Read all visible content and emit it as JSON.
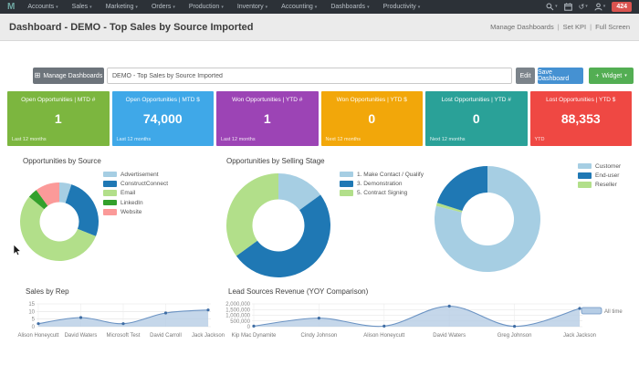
{
  "topnav": {
    "logo": "M",
    "menus": [
      "Accounts",
      "Sales",
      "Marketing",
      "Orders",
      "Production",
      "Inventory",
      "Accounting",
      "Dashboards",
      "Productivity"
    ],
    "icons": [
      "search-icon",
      "calendar-icon",
      "history-icon",
      "user-icon"
    ],
    "notification_badge": "424"
  },
  "titlebar": {
    "title": "Dashboard - DEMO - Top Sales by Source Imported",
    "links": [
      "Manage Dashboards",
      "Set KPI",
      "Full Screen"
    ]
  },
  "toolbar": {
    "manage_label": "Manage Dashboards",
    "dashboard_name": "DEMO - Top Sales by Source Imported",
    "edit_label": "Edit",
    "save_label": "Save Dashboard",
    "widget_plus": "+",
    "widget_label": "Widget"
  },
  "kpi_cards": [
    {
      "title": "Open Opportunities | MTD #",
      "value": "1",
      "footer": "Last 12 months",
      "color": "#7cb63f"
    },
    {
      "title": "Open Opportunities | MTD $",
      "value": "74,000",
      "footer": "Last 12 months",
      "color": "#3fa8e8"
    },
    {
      "title": "Won Opportunities | YTD #",
      "value": "1",
      "footer": "Last 12 months",
      "color": "#9c44b5"
    },
    {
      "title": "Won Opportunities | YTD $",
      "value": "0",
      "footer": "Next 12 months",
      "color": "#f2a70a"
    },
    {
      "title": "Lost Opportunities | YTD #",
      "value": "0",
      "footer": "Next 12 months",
      "color": "#2aa198"
    },
    {
      "title": "Lost Opportunities | YTD $",
      "value": "88,353",
      "footer": "YTD",
      "color": "#ef4843"
    }
  ],
  "chart_data": [
    {
      "type": "donut",
      "title": "Opportunities by Source",
      "legend_position": "right",
      "segments": [
        {
          "label": "Advertisement",
          "value": 5,
          "color": "#A6CEE3"
        },
        {
          "label": "ConstructConnect",
          "value": 26,
          "color": "#1F78B4"
        },
        {
          "label": "Email",
          "value": 55,
          "color": "#B2DF8A"
        },
        {
          "label": "LinkedIn",
          "value": 4,
          "color": "#33A02C"
        },
        {
          "label": "Website",
          "value": 10,
          "color": "#FB9A99"
        }
      ],
      "legend_order": [
        0,
        1,
        2,
        3,
        4
      ]
    },
    {
      "type": "donut",
      "title": "Opportunities by Selling Stage",
      "legend_position": "right",
      "segments": [
        {
          "label": "1. Make Contact / Qualify",
          "value": 15,
          "color": "#A6CEE3"
        },
        {
          "label": "3. Demonstration",
          "value": 50,
          "color": "#1F78B4"
        },
        {
          "label": "5. Contract Signing",
          "value": 35,
          "color": "#B2DF8A"
        }
      ],
      "legend_order": [
        0,
        1,
        2
      ]
    },
    {
      "type": "donut",
      "title": "",
      "legend_position": "right",
      "segments": [
        {
          "label": "Customer",
          "value": 79,
          "color": "#A6CEE3"
        },
        {
          "label": "Reseller",
          "value": 1,
          "color": "#B2DF8A"
        },
        {
          "label": "End-user",
          "value": 20,
          "color": "#1F78B4"
        }
      ],
      "legend_order": [
        0,
        2,
        1
      ]
    },
    {
      "type": "area",
      "title": "Sales by Rep",
      "categories": [
        "Alison Honeycutt",
        "David Waters",
        "Microsoft Test",
        "David Carroll",
        "Jack Jackson"
      ],
      "values": [
        2,
        6,
        2,
        9,
        11
      ],
      "ylim": [
        0,
        15
      ],
      "yticks": [
        0,
        5,
        10,
        15
      ],
      "ytick_labels": [
        "0",
        "5",
        "10",
        "15"
      ],
      "grid": true
    },
    {
      "type": "area",
      "title": "Lead Sources Revenue (YOY Comparison)",
      "categories": [
        "Kip Mac Dynamite",
        "Cindy Johnson",
        "Alison Honeycutt",
        "David Waters",
        "Greg Johnson",
        "Jack Jackson"
      ],
      "values": [
        50000,
        750000,
        50000,
        1800000,
        30000,
        1600000
      ],
      "ylim": [
        0,
        2000000
      ],
      "yticks": [
        0,
        500000,
        1000000,
        1500000,
        2000000
      ],
      "ytick_labels": [
        "0",
        "500,000",
        "1,000,000",
        "1,500,000",
        "2,000,000"
      ],
      "legend": [
        "All time"
      ],
      "legend_position": "right",
      "grid": true
    }
  ],
  "colors": {
    "area_fill": "#b6cde5",
    "area_line": "#6b93c3",
    "area_dot": "#3f6da4",
    "nav_bg": "#2c3137",
    "badge_bg": "#d9534f",
    "save_btn": "#4591d2",
    "widget_btn": "#53ae53"
  }
}
